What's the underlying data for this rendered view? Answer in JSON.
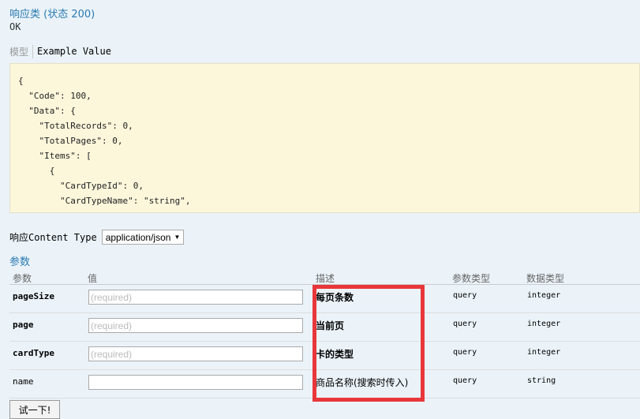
{
  "response": {
    "title": "响应类 (状态 200)",
    "status": "OK"
  },
  "model_tabs": {
    "model": "模型",
    "example": "Example Value"
  },
  "example_json": "{\n  \"Code\": 100,\n  \"Data\": {\n    \"TotalRecords\": 0,\n    \"TotalPages\": 0,\n    \"Items\": [\n      {\n        \"CardTypeId\": 0,\n        \"CardTypeName\": \"string\",\n        \"Name\": \"string\",",
  "content_type": {
    "label": "响应Content Type",
    "value": "application/json"
  },
  "params": {
    "title": "参数",
    "headers": {
      "param": "参数",
      "value": "值",
      "desc": "描述",
      "param_type": "参数类型",
      "data_type": "数据类型"
    },
    "rows": [
      {
        "name": "pageSize",
        "placeholder": "(required)",
        "desc": "每页条数",
        "param_type": "query",
        "data_type": "integer"
      },
      {
        "name": "page",
        "placeholder": "(required)",
        "desc": "当前页",
        "param_type": "query",
        "data_type": "integer"
      },
      {
        "name": "cardType",
        "placeholder": "(required)",
        "desc": "卡的类型",
        "param_type": "query",
        "data_type": "integer"
      },
      {
        "name": "name",
        "placeholder": "",
        "desc": "商品名称(搜索时传入)",
        "param_type": "query",
        "data_type": "string"
      }
    ]
  },
  "try_button": "试一下!",
  "colors": {
    "link": "#2a7ab0",
    "highlight_box": "#e8373a",
    "code_bg": "#fcf6db"
  }
}
